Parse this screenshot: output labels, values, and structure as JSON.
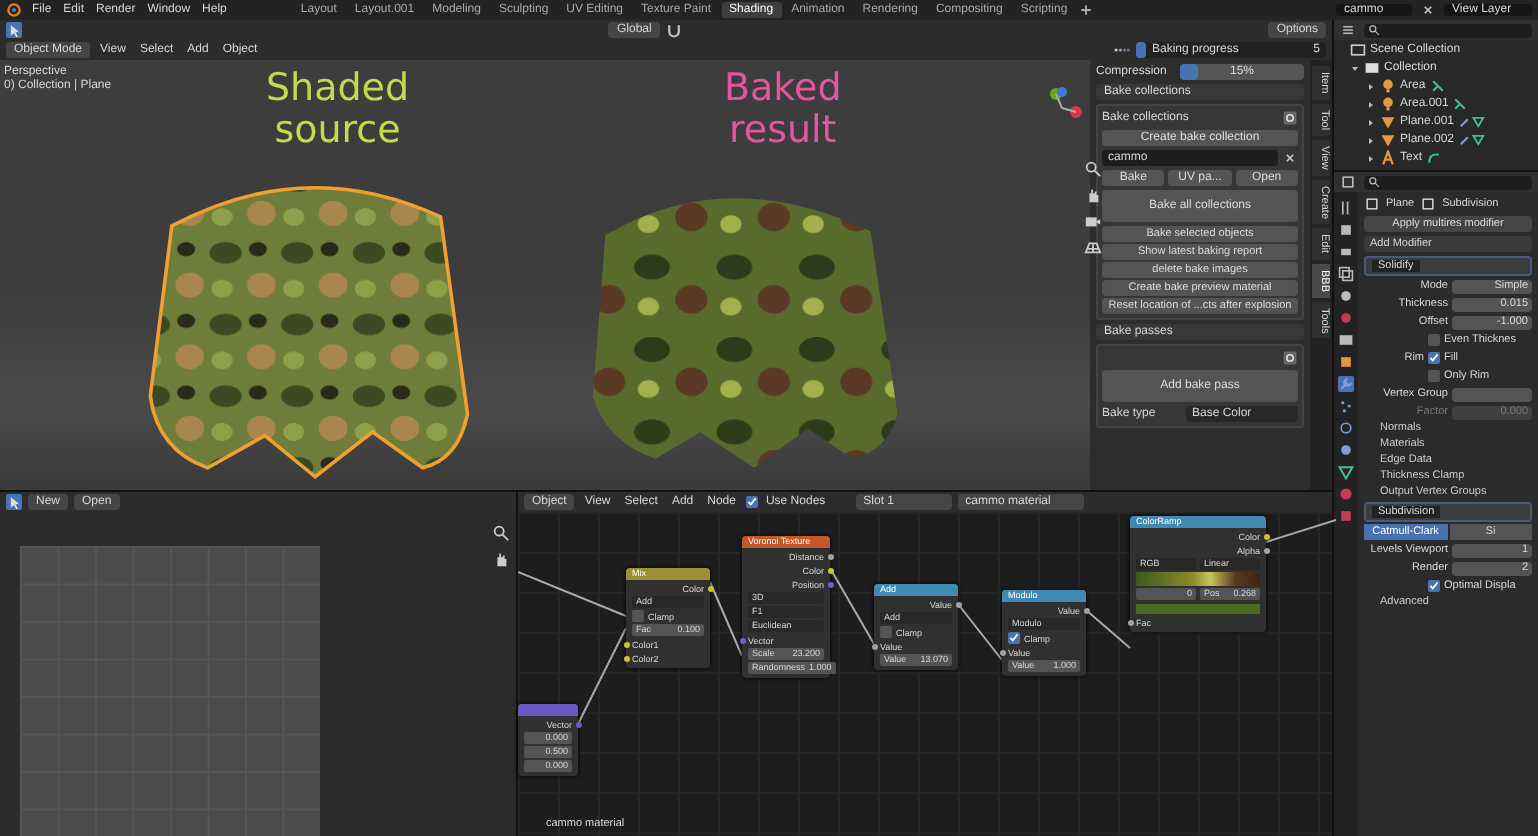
{
  "menu": [
    "File",
    "Edit",
    "Render",
    "Window",
    "Help"
  ],
  "workspaces": [
    {
      "label": "Layout",
      "selected": false
    },
    {
      "label": "Layout.001",
      "selected": false
    },
    {
      "label": "Modeling",
      "selected": false
    },
    {
      "label": "Sculpting",
      "selected": false
    },
    {
      "label": "UV Editing",
      "selected": false
    },
    {
      "label": "Texture Paint",
      "selected": false
    },
    {
      "label": "Shading",
      "selected": true
    },
    {
      "label": "Animation",
      "selected": false
    },
    {
      "label": "Rendering",
      "selected": false
    },
    {
      "label": "Compositing",
      "selected": false
    },
    {
      "label": "Scripting",
      "selected": false
    }
  ],
  "scene": "cammo",
  "view_layer": "View Layer",
  "viewport": {
    "mode": "Object Mode",
    "menus": [
      "View",
      "Select",
      "Add",
      "Object"
    ],
    "orientation": "Global",
    "options": "Options",
    "overlay": [
      "Perspective",
      "0) Collection | Plane"
    ],
    "labels": [
      {
        "lines": [
          "Shaded",
          "source"
        ],
        "color": "#c6d94a"
      },
      {
        "lines": [
          "Baked",
          "result"
        ],
        "color": "#e2559f"
      }
    ],
    "objects": [
      {
        "selected": true
      },
      {
        "selected": false
      }
    ]
  },
  "npanel": {
    "progress": {
      "label": "Baking progress",
      "value": "5",
      "level": 0.05
    },
    "compression": {
      "label": "Compression",
      "value": "15%",
      "level": 0.15
    },
    "tabs": [
      {
        "label": "Item",
        "selected": false
      },
      {
        "label": "Tool",
        "selected": false
      },
      {
        "label": "View",
        "selected": false
      },
      {
        "label": "Create",
        "selected": false
      },
      {
        "label": "Edit",
        "selected": false
      },
      {
        "label": "BBB",
        "selected": true
      },
      {
        "label": "Tools",
        "selected": false
      }
    ],
    "bake_collections": {
      "title": "Bake collections",
      "subtitle": "Bake collections",
      "create": "Create bake collection",
      "name": "cammo",
      "buttons": [
        "Bake",
        "UV pa...",
        "Open"
      ],
      "bake_all": "Bake all collections",
      "actions": [
        "Bake selected objects",
        "Show latest baking report",
        "delete bake images",
        "Create bake preview material",
        "Reset location of ...cts after explosion"
      ]
    },
    "bake_passes": {
      "title": "Bake passes",
      "add": "Add bake pass",
      "type_label": "Bake type",
      "type_value": "Base Color"
    }
  },
  "image_editor": {
    "buttons": [
      "New",
      "Open"
    ]
  },
  "node_editor": {
    "editor": "Object",
    "menus": [
      "View",
      "Select",
      "Add",
      "Node"
    ],
    "use_nodes": {
      "label": "Use Nodes",
      "checked": true
    },
    "slot": "Slot 1",
    "material": "cammo material",
    "footer": "cammo material",
    "nodes": [
      {
        "color": "#6b57c4",
        "rows": [
          {
            "kind": "output",
            "label": "Vector",
            "color": "#6363c7"
          },
          {
            "kind": "field",
            "value": "0.000"
          },
          {
            "kind": "field",
            "value": "0.500"
          },
          {
            "kind": "field",
            "value": "0.000"
          }
        ]
      },
      {
        "title": "Mix",
        "color": "#9b9032",
        "rows": [
          {
            "kind": "output",
            "label": "Color",
            "color": "#c7c729"
          },
          {
            "kind": "menu",
            "label": "Add"
          },
          {
            "kind": "check",
            "label": "Clamp",
            "checked": false
          },
          {
            "kind": "field",
            "label": "Fac",
            "value": "0.100"
          },
          {
            "kind": "input",
            "label": "Color1",
            "color": "#c7c729"
          },
          {
            "kind": "input",
            "label": "Color2",
            "color": "#c7c729"
          }
        ]
      },
      {
        "title": "Voronoi Texture",
        "color": "#c3582b",
        "rows": [
          {
            "kind": "output",
            "label": "Distance",
            "color": "#a1a1a1"
          },
          {
            "kind": "output",
            "label": "Color",
            "color": "#c7c729"
          },
          {
            "kind": "output",
            "label": "Position",
            "color": "#6363c7"
          },
          {
            "kind": "menu",
            "label": "3D"
          },
          {
            "kind": "menu",
            "label": "F1"
          },
          {
            "kind": "menu",
            "label": "Euclidean"
          },
          {
            "kind": "input",
            "label": "Vector",
            "color": "#6363c7"
          },
          {
            "kind": "field",
            "label": "Scale",
            "value": "23.200"
          },
          {
            "kind": "field",
            "label": "Randomness",
            "value": "1.000"
          }
        ]
      },
      {
        "title": "Add",
        "color": "#3f8ab3",
        "rows": [
          {
            "kind": "output",
            "label": "Value",
            "color": "#a1a1a1"
          },
          {
            "kind": "menu",
            "label": "Add"
          },
          {
            "kind": "check",
            "label": "Clamp",
            "checked": false
          },
          {
            "kind": "input",
            "label": "Value",
            "color": "#a1a1a1"
          },
          {
            "kind": "field",
            "label": "Value",
            "value": "13.070"
          }
        ]
      },
      {
        "title": "Modulo",
        "color": "#3f8ab3",
        "rows": [
          {
            "kind": "output",
            "label": "Value",
            "color": "#a1a1a1"
          },
          {
            "kind": "menu",
            "label": "Modulo"
          },
          {
            "kind": "check",
            "label": "Clamp",
            "checked": true
          },
          {
            "kind": "input",
            "label": "Value",
            "color": "#a1a1a1"
          },
          {
            "kind": "field",
            "label": "Value",
            "value": "1.000"
          }
        ]
      },
      {
        "title": "ColorRamp",
        "color": "#3f8ab3",
        "rows": [
          {
            "kind": "output",
            "label": "Color",
            "color": "#c7c729"
          },
          {
            "kind": "output",
            "label": "Alpha",
            "color": "#a1a1a1"
          },
          {
            "kind": "menu_pair",
            "items": [
              "RGB",
              "Linear"
            ]
          },
          {
            "kind": "ramp"
          },
          {
            "kind": "field_pair",
            "items": [
              {
                "value": "0"
              },
              {
                "label": "Pos",
                "value": "0.268"
              }
            ]
          },
          {
            "kind": "swatch",
            "color": "#4d6a22"
          },
          {
            "kind": "input",
            "label": "Fac",
            "color": "#a1a1a1"
          }
        ]
      }
    ]
  },
  "outliner": {
    "items": [
      {
        "label": "Scene Collection",
        "children": [
          {
            "label": "Collection",
            "expanded": true,
            "children": [
              {
                "label": "Area",
                "kind": "light",
                "expanded": false
              },
              {
                "label": "Area.001",
                "kind": "light",
                "expanded": false
              },
              {
                "label": "Plane.001",
                "kind": "mesh",
                "expanded": false
              },
              {
                "label": "Plane.002",
                "kind": "mesh",
                "expanded": false
              },
              {
                "label": "Text",
                "kind": "text",
                "expanded": false
              }
            ]
          }
        ]
      }
    ]
  },
  "properties": {
    "object": "Plane",
    "modifier": "Subdivision",
    "apply": "Apply multires modifier",
    "add_modifier": "Add Modifier",
    "rows": [
      {
        "kind": "header",
        "label": "Solidify"
      },
      {
        "kind": "field",
        "label": "Mode",
        "value": "Simple"
      },
      {
        "kind": "field",
        "label": "Thickness",
        "value": "0.015"
      },
      {
        "kind": "field",
        "label": "Offset",
        "value": "-1.000"
      },
      {
        "kind": "check",
        "text": "Even Thicknes",
        "checked": false
      },
      {
        "kind": "check",
        "label": "Rim",
        "text": "Fill",
        "checked": true
      },
      {
        "kind": "check",
        "text": "Only Rim",
        "checked": false
      },
      {
        "kind": "field",
        "label": "Vertex Group"
      },
      {
        "kind": "field",
        "label": "Factor",
        "value": "0.000",
        "disabled": true
      },
      {
        "kind": "sub",
        "label": "Normals"
      },
      {
        "kind": "sub",
        "label": "Materials"
      },
      {
        "kind": "sub",
        "label": "Edge Data"
      },
      {
        "kind": "sub",
        "label": "Thickness Clamp"
      },
      {
        "kind": "sub",
        "label": "Output Vertex Groups"
      },
      {
        "kind": "header",
        "label": "Subdivision"
      },
      {
        "kind": "segmented",
        "items": [
          {
            "label": "Catmull-Clark",
            "selected": true
          },
          {
            "label": "Si",
            "selected": false
          }
        ]
      },
      {
        "kind": "field",
        "label": "Levels Viewport",
        "value": "1"
      },
      {
        "kind": "field",
        "label": "Render",
        "value": "2"
      },
      {
        "kind": "check",
        "text": "Optimal Displa",
        "checked": true
      },
      {
        "kind": "sub",
        "label": "Advanced"
      }
    ]
  }
}
